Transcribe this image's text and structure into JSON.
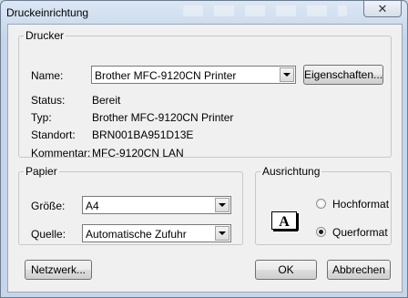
{
  "window": {
    "title": "Druckeinrichtung",
    "close_glyph": "✕"
  },
  "printer": {
    "legend": "Drucker",
    "name_label": "Name:",
    "name_value": "Brother MFC-9120CN Printer",
    "properties_button": "Eigenschaften...",
    "status_label": "Status:",
    "status_value": "Bereit",
    "type_label": "Typ:",
    "type_value": "Brother MFC-9120CN Printer",
    "location_label": "Standort:",
    "location_value": "BRN001BA951D13E",
    "comment_label": "Kommentar:",
    "comment_value": "MFC-9120CN LAN"
  },
  "paper": {
    "legend": "Papier",
    "size_label": "Größe:",
    "size_value": "A4",
    "source_label": "Quelle:",
    "source_value": "Automatische Zufuhr"
  },
  "orientation": {
    "legend": "Ausrichtung",
    "icon_letter": "A",
    "portrait_label": "Hochformat",
    "landscape_label": "Querformat",
    "selected": "Querformat"
  },
  "footer": {
    "network_button": "Netzwerk...",
    "ok_button": "OK",
    "cancel_button": "Abbrechen"
  }
}
